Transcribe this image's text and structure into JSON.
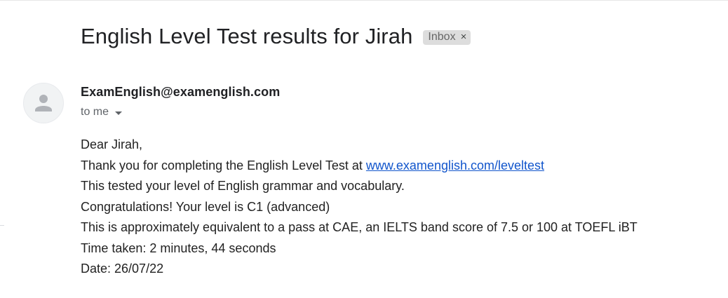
{
  "email": {
    "subject": "English Level Test results for Jirah",
    "label": "Inbox",
    "label_close": "×",
    "sender": "ExamEnglish@examenglish.com",
    "recipient": "to me",
    "body": {
      "greeting": "Dear Jirah,",
      "line1_prefix": "Thank you for completing the English Level Test at ",
      "line1_link": "www.examenglish.com/leveltest",
      "line2": "This tested your level of English grammar and vocabulary.",
      "line3": "Congratulations! Your level is C1 (advanced)",
      "line4": "This is approximately equivalent to a pass at CAE, an IELTS band score of 7.5 or 100 at TOEFL iBT",
      "line5": "Time taken: 2 minutes, 44 seconds",
      "line6": "Date: 26/07/22"
    }
  },
  "icons": {
    "avatar": "default-person-icon",
    "recipient_toggle": "caret-down-icon",
    "label_remove": "close-icon"
  },
  "colors": {
    "link": "#1155cc",
    "text": "#222222",
    "label_chip_bg": "#dddddd"
  }
}
